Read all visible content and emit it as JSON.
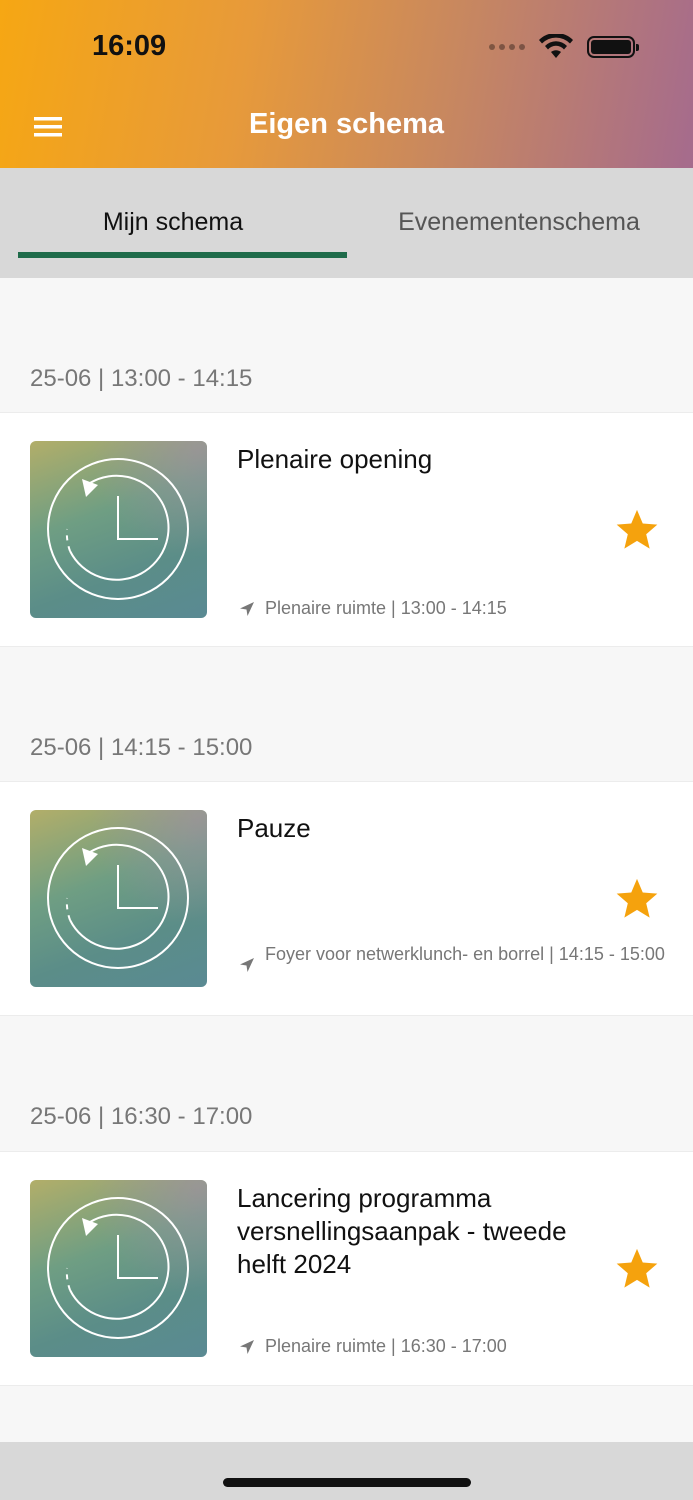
{
  "status_bar": {
    "time": "16:09"
  },
  "header": {
    "title": "Eigen schema",
    "menu_icon": "hamburger-menu-icon"
  },
  "tabs": [
    {
      "label": "Mijn schema",
      "active": true
    },
    {
      "label": "Evenementenschema",
      "active": false
    }
  ],
  "sessions": [
    {
      "slot": "25-06 | 13:00 - 14:15",
      "title": "Plenaire opening",
      "location": "Plenaire ruimte | 13:00 - 14:15",
      "favorited": true
    },
    {
      "slot": "25-06 | 14:15 - 15:00",
      "title": "Pauze",
      "location": "Foyer voor netwerklunch- en borrel | 14:15 - 15:00",
      "favorited": true
    },
    {
      "slot": "25-06 | 16:30 - 17:00",
      "title": "Lancering programma versnellingsaanpak - tweede helft 2024",
      "location": "Plenaire ruimte | 16:30 - 17:00",
      "favorited": true
    }
  ],
  "colors": {
    "accent_star": "#f5a20d",
    "tab_indicator": "#1f6b4a"
  }
}
